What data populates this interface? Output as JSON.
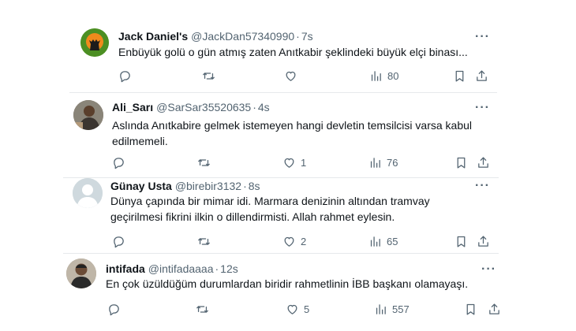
{
  "tweets": [
    {
      "name": "Jack Daniel's",
      "handle": "@JackDan57340990",
      "sep": "·",
      "time": "7s",
      "more": "···",
      "lines": [
        "Enbüyük golü o gün atmış zaten Anıtkabir şeklindeki büyük elçi binası..."
      ],
      "likes": "",
      "views": "80"
    },
    {
      "name": "Ali_Sarı",
      "handle": "@SarSar35520635",
      "sep": "·",
      "time": "4s",
      "more": "···",
      "lines": [
        "Aslında Anıtkabire gelmek istemeyen hangi devletin temsilcisi varsa kabul",
        "edilmemeli."
      ],
      "likes": "1",
      "views": "76"
    },
    {
      "name": "Günay Usta",
      "handle": "@birebir3132",
      "sep": "·",
      "time": "8s",
      "more": "···",
      "lines": [
        "Dünya çapında bir mimar idi. Marmara denizinin altından tramvay",
        "geçirilmesi fikrini ilkin o dillendirmisti. Allah rahmet eylesin."
      ],
      "likes": "2",
      "views": "65"
    },
    {
      "name": "intifada",
      "handle": "@intifadaaaa",
      "sep": "·",
      "time": "12s",
      "more": "···",
      "lines": [
        "En çok üzüldüğüm durumlardan biridir rahmetlinin İBB başkanı olamayaşı."
      ],
      "likes": "5",
      "views": "557"
    }
  ],
  "icons": {
    "reply": "reply-icon",
    "retweet": "retweet-icon",
    "like": "like-icon",
    "views": "views-icon",
    "bookmark": "bookmark-icon",
    "share": "share-icon"
  },
  "colors": {
    "text": "#0f1419",
    "secondary": "#536471",
    "divider": "#e6e9eb",
    "avatar1_bg": "#5a9c2e",
    "avatar1_fg": "#f08a1c"
  }
}
